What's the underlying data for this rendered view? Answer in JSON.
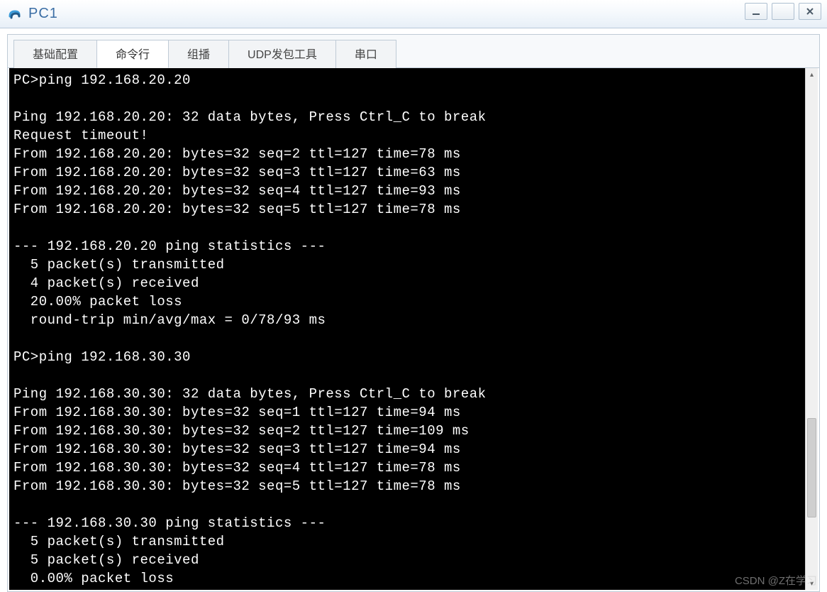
{
  "window": {
    "title": "PC1",
    "logo_color_a": "#3a9bd9",
    "logo_color_b": "#1f5a8a"
  },
  "tabs": [
    {
      "label": "基础配置",
      "active": false
    },
    {
      "label": "命令行",
      "active": true
    },
    {
      "label": "组播",
      "active": false
    },
    {
      "label": "UDP发包工具",
      "active": false
    },
    {
      "label": "串口",
      "active": false
    }
  ],
  "terminal_lines": [
    "PC>ping 192.168.20.20",
    "",
    "Ping 192.168.20.20: 32 data bytes, Press Ctrl_C to break",
    "Request timeout!",
    "From 192.168.20.20: bytes=32 seq=2 ttl=127 time=78 ms",
    "From 192.168.20.20: bytes=32 seq=3 ttl=127 time=63 ms",
    "From 192.168.20.20: bytes=32 seq=4 ttl=127 time=93 ms",
    "From 192.168.20.20: bytes=32 seq=5 ttl=127 time=78 ms",
    "",
    "--- 192.168.20.20 ping statistics ---",
    "  5 packet(s) transmitted",
    "  4 packet(s) received",
    "  20.00% packet loss",
    "  round-trip min/avg/max = 0/78/93 ms",
    "",
    "PC>ping 192.168.30.30",
    "",
    "Ping 192.168.30.30: 32 data bytes, Press Ctrl_C to break",
    "From 192.168.30.30: bytes=32 seq=1 ttl=127 time=94 ms",
    "From 192.168.30.30: bytes=32 seq=2 ttl=127 time=109 ms",
    "From 192.168.30.30: bytes=32 seq=3 ttl=127 time=94 ms",
    "From 192.168.30.30: bytes=32 seq=4 ttl=127 time=78 ms",
    "From 192.168.30.30: bytes=32 seq=5 ttl=127 time=78 ms",
    "",
    "--- 192.168.30.30 ping statistics ---",
    "  5 packet(s) transmitted",
    "  5 packet(s) received",
    "  0.00% packet loss"
  ],
  "watermark": "CSDN @Z在学习"
}
